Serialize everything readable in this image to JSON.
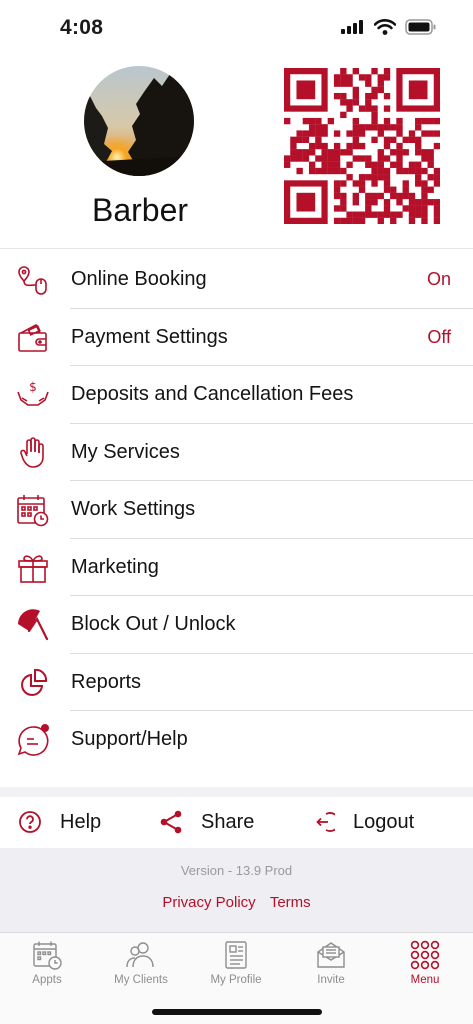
{
  "status_bar": {
    "time": "4:08"
  },
  "profile": {
    "name": "Barber"
  },
  "menu": [
    {
      "label": "Online Booking",
      "value": "On",
      "icon": "location-mouse-icon"
    },
    {
      "label": "Payment Settings",
      "value": "Off",
      "icon": "wallet-icon"
    },
    {
      "label": "Deposits and Cancellation Fees",
      "value": "",
      "icon": "hands-dollar-icon"
    },
    {
      "label": "My Services",
      "value": "",
      "icon": "hand-icon"
    },
    {
      "label": "Work Settings",
      "value": "",
      "icon": "calendar-clock-icon"
    },
    {
      "label": "Marketing",
      "value": "",
      "icon": "gift-icon"
    },
    {
      "label": "Block Out / Unlock",
      "value": "",
      "icon": "umbrella-icon"
    },
    {
      "label": "Reports",
      "value": "",
      "icon": "pie-chart-icon"
    },
    {
      "label": "Support/Help",
      "value": "",
      "icon": "chat-bubble-icon"
    }
  ],
  "actions": {
    "help": "Help",
    "share": "Share",
    "logout": "Logout"
  },
  "footer": {
    "version": "Version - 13.9 Prod",
    "privacy": "Privacy Policy",
    "terms": "Terms"
  },
  "tabs": {
    "appts": "Appts",
    "clients": "My Clients",
    "profile": "My Profile",
    "invite": "Invite",
    "menu": "Menu",
    "active": "Menu"
  },
  "colors": {
    "accent": "#b5102a",
    "text": "#141414",
    "muted": "#8e8e8e"
  }
}
